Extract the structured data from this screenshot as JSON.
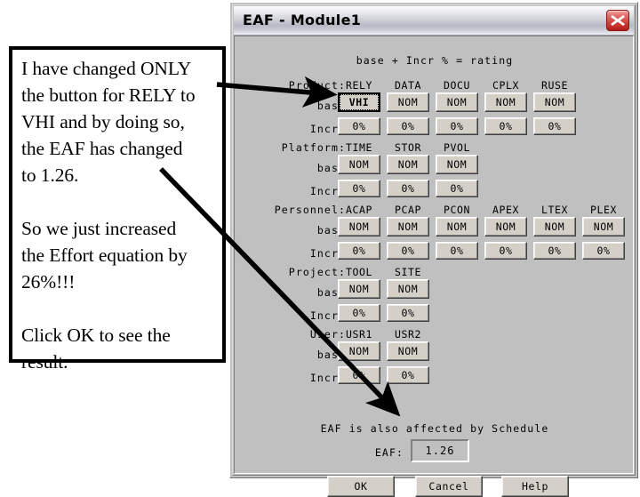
{
  "annotation": {
    "paragraphs": [
      "I have changed ONLY the button for RELY to VHI and by doing so, the EAF has changed to 1.26.",
      "So we just increased the Effort equation by 26%!!!",
      "Click OK to see the result."
    ],
    "lines": [
      "I have changed ONLY",
      "the button for RELY to",
      "VHI and by doing so,",
      "the EAF has changed",
      "to 1.26.",
      "So we just increased",
      "the Effort equation by",
      "26%!!!",
      "Click OK to see the",
      "result."
    ]
  },
  "dialog": {
    "title": "EAF - Module1",
    "close_label": "close-icon",
    "formula": "base + Incr % = rating",
    "base_label": "base",
    "incr_label": "Incr%",
    "groups": [
      {
        "label": "Product:",
        "columns": [
          {
            "name": "RELY",
            "base": "VHI",
            "incr": "0%",
            "changed": true
          },
          {
            "name": "DATA",
            "base": "NOM",
            "incr": "0%",
            "changed": false
          },
          {
            "name": "DOCU",
            "base": "NOM",
            "incr": "0%",
            "changed": false
          },
          {
            "name": "CPLX",
            "base": "NOM",
            "incr": "0%",
            "changed": false
          },
          {
            "name": "RUSE",
            "base": "NOM",
            "incr": "0%",
            "changed": false
          }
        ]
      },
      {
        "label": "Platform:",
        "columns": [
          {
            "name": "TIME",
            "base": "NOM",
            "incr": "0%",
            "changed": false
          },
          {
            "name": "STOR",
            "base": "NOM",
            "incr": "0%",
            "changed": false
          },
          {
            "name": "PVOL",
            "base": "NOM",
            "incr": "0%",
            "changed": false
          }
        ]
      },
      {
        "label": "Personnel:",
        "columns": [
          {
            "name": "ACAP",
            "base": "NOM",
            "incr": "0%",
            "changed": false
          },
          {
            "name": "PCAP",
            "base": "NOM",
            "incr": "0%",
            "changed": false
          },
          {
            "name": "PCON",
            "base": "NOM",
            "incr": "0%",
            "changed": false
          },
          {
            "name": "APEX",
            "base": "NOM",
            "incr": "0%",
            "changed": false
          },
          {
            "name": "LTEX",
            "base": "NOM",
            "incr": "0%",
            "changed": false
          },
          {
            "name": "PLEX",
            "base": "NOM",
            "incr": "0%",
            "changed": false
          }
        ]
      },
      {
        "label": "Project:",
        "columns": [
          {
            "name": "TOOL",
            "base": "NOM",
            "incr": "0%",
            "changed": false
          },
          {
            "name": "SITE",
            "base": "NOM",
            "incr": "0%",
            "changed": false
          }
        ]
      },
      {
        "label": "User:",
        "columns": [
          {
            "name": "USR1",
            "base": "NOM",
            "incr": "0%",
            "changed": false
          },
          {
            "name": "USR2",
            "base": "NOM",
            "incr": "0%",
            "changed": false
          }
        ]
      }
    ],
    "eaf_note": "EAF is also affected by Schedule",
    "eaf_label": "EAF:",
    "eaf_value": "1.26",
    "actions": [
      {
        "label": "OK"
      },
      {
        "label": "Cancel"
      },
      {
        "label": "Help"
      }
    ]
  },
  "colors": {
    "dialog_face": "#c0c0c0",
    "button_face": "#d4d0c8",
    "close_red": "#c9332e",
    "titlebar_silver": "#c9cbd4",
    "text": "#000000"
  }
}
